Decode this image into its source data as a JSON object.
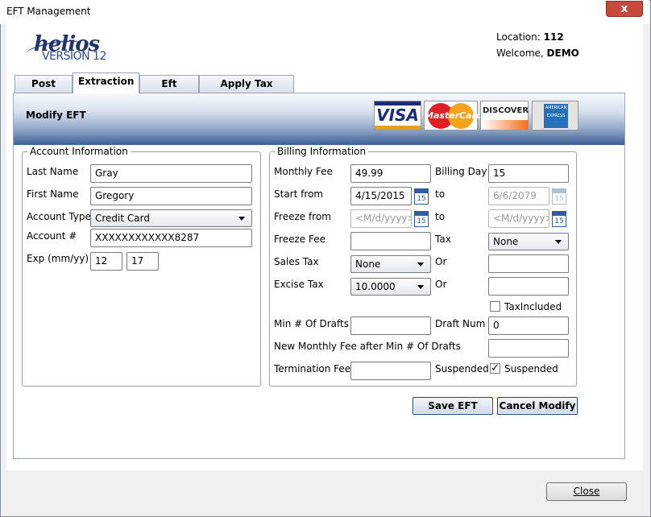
{
  "window": {
    "title": "EFT Management",
    "close_glyph": "x"
  },
  "brand": {
    "name": "helios",
    "version": "VERSION 12"
  },
  "session": {
    "location_label": "Location:",
    "location_value": "112",
    "welcome_label": "Welcome,",
    "welcome_value": "DEMO"
  },
  "tabs": [
    {
      "label": "Post Info"
    },
    {
      "label": "Extraction"
    },
    {
      "label": "Eft Bonus"
    },
    {
      "label": "Apply Tax Utility"
    }
  ],
  "header": {
    "title": "Modify EFT"
  },
  "cards": {
    "visa": "VISA",
    "mastercard": "MasterCard",
    "discover": "DISCOVER",
    "amex": "AMERICAN EXPRESS"
  },
  "account": {
    "legend": "Account Information",
    "last_name_label": "Last Name",
    "last_name": "Gray",
    "first_name_label": "First Name",
    "first_name": "Gregory",
    "account_type_label": "Account Type",
    "account_type": "Credit Card",
    "account_num_label": "Account #",
    "account_num": "XXXXXXXXXXXX8287",
    "exp_label": "Exp (mm/yy)",
    "exp_month": "12",
    "exp_year": "17"
  },
  "billing": {
    "legend": "Billing Information",
    "monthly_fee_label": "Monthly Fee",
    "monthly_fee": "49.99",
    "billing_day_label": "Billing Day",
    "billing_day": "15",
    "start_from_label": "Start from",
    "start_from": "4/15/2015",
    "to_label": "to",
    "start_to": "6/6/2079",
    "freeze_from_label": "Freeze from",
    "freeze_from_placeholder": "<M/d/yyyy>",
    "freeze_to_placeholder": "<M/d/yyyy>",
    "freeze_fee_label": "Freeze Fee",
    "freeze_fee": "",
    "tax_label": "Tax",
    "tax": "None",
    "sales_tax_label": "Sales Tax",
    "sales_tax": "None",
    "or_label": "Or",
    "sales_tax_or": "",
    "excise_tax_label": "Excise Tax",
    "excise_tax": "10.0000",
    "excise_or": "",
    "tax_included_label": "TaxIncluded",
    "tax_included": false,
    "min_drafts_label": "Min # Of Drafts",
    "min_drafts": "",
    "draft_num_label": "Draft Num",
    "draft_num": "0",
    "new_monthly_fee_label": "New Monthly Fee after Min # Of Drafts",
    "new_monthly_fee": "",
    "termination_fee_label": "Termination Fee",
    "termination_fee": "",
    "suspended_label": "Suspended",
    "suspended_check_label": "Suspended",
    "suspended": true,
    "calendar_day": "15"
  },
  "actions": {
    "save": "Save EFT",
    "cancel": "Cancel Modify",
    "close": "Close"
  }
}
